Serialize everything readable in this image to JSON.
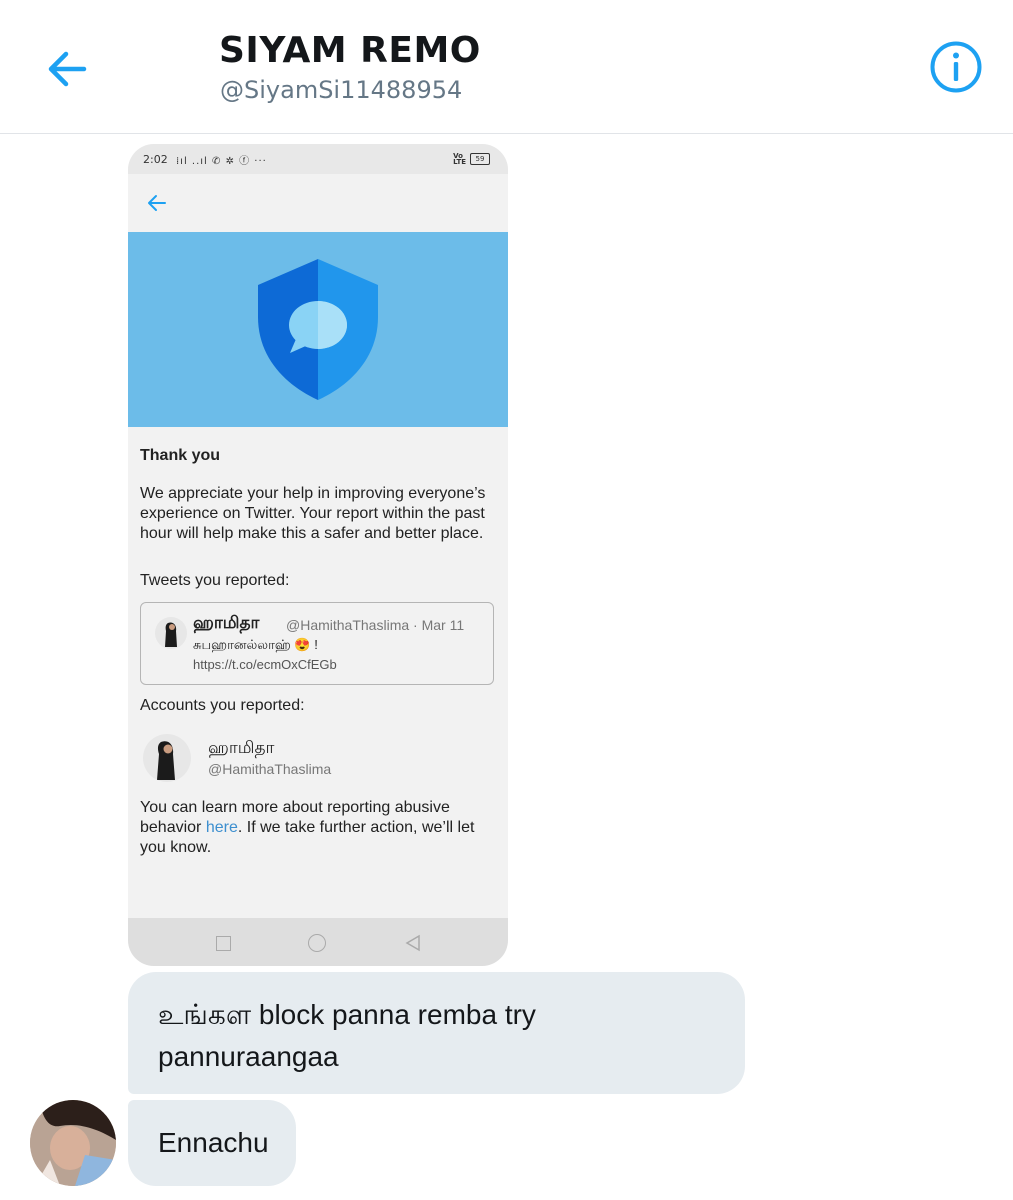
{
  "header": {
    "name": "SIYAM REMO",
    "handle": "@SiyamSi11488954",
    "accent": "#1da1f2"
  },
  "attachment": {
    "statusbar": {
      "time": "2:02",
      "battery": "59"
    },
    "thank_you": "Thank you",
    "paragraph": "We appreciate your help in improving everyone’s experience on Twitter. Your report within the past hour will help make this a safer and better place.",
    "tweets_label": "Tweets you reported:",
    "tweet": {
      "name": "ஹாமிதா",
      "meta": "@HamithaThaslima · Mar 11",
      "text": "சுபஹானல்லாஹ் 😍 !",
      "link": "https://t.co/ecmOxCfEGb"
    },
    "accounts_label": "Accounts you reported:",
    "account": {
      "name": "ஹாமிதா",
      "handle": "@HamithaThaslima"
    },
    "learn": {
      "before": "You can learn more about reporting abusive behavior ",
      "link": "here",
      "after": ". If we take further action, we’ll let you know."
    },
    "banner_color": "#6cbce9"
  },
  "messages": [
    {
      "text": "உங்கள block panna remba try pannuraangaa"
    },
    {
      "text": "Ennachu"
    }
  ]
}
